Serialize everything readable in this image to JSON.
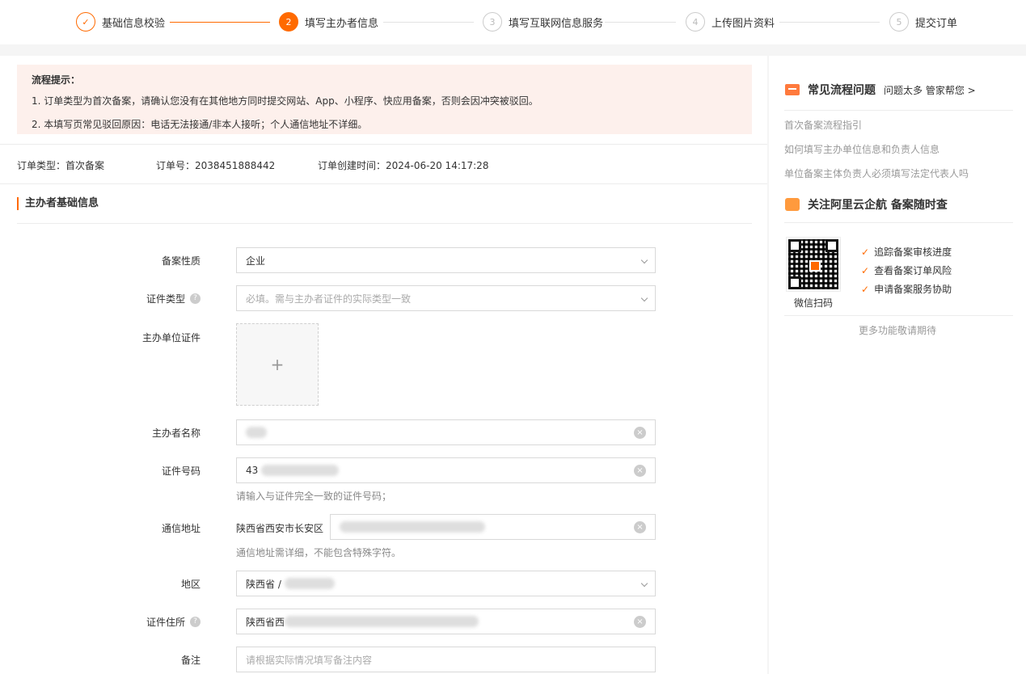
{
  "stepper": {
    "steps": [
      {
        "num": "✓",
        "label": "基础信息校验"
      },
      {
        "num": "2",
        "label": "填写主办者信息"
      },
      {
        "num": "3",
        "label": "填写互联网信息服务"
      },
      {
        "num": "4",
        "label": "上传图片资料"
      },
      {
        "num": "5",
        "label": "提交订单"
      }
    ]
  },
  "notice": {
    "title": "流程提示：",
    "line1": "1. 订单类型为首次备案，请确认您没有在其他地方同时提交网站、App、小程序、快应用备案，否则会因冲突被驳回。",
    "line2": "2. 本填写页常见驳回原因：电话无法接通/非本人接听；个人通信地址不详细。"
  },
  "order": {
    "type": "订单类型：首次备案",
    "number": "订单号：2038451888442",
    "created": "订单创建时间：2024-06-20 14:17:28"
  },
  "section": {
    "title": "主办者基础信息"
  },
  "form": {
    "record_nature_label": "备案性质",
    "record_nature_value": "企业",
    "cert_type_label": "证件类型",
    "cert_type_placeholder": "必填。需与主办者证件的实际类型一致",
    "org_cert_label": "主办单位证件",
    "upload_plus": "+",
    "sponsor_name_label": "主办者名称",
    "cert_number_label": "证件号码",
    "cert_number_value": "43",
    "cert_number_hint": "请输入与证件完全一致的证件号码；",
    "address_label": "通信地址",
    "address_prefix": "陕西省西安市长安区",
    "address_hint": "通信地址需详细，不能包含特殊字符。",
    "region_label": "地区",
    "region_value": "陕西省 /",
    "cert_address_label": "证件住所",
    "cert_address_value": "陕西省西",
    "remark_label": "备注",
    "remark_placeholder": "请根据实际情况填写备注内容",
    "help_glyph": "?",
    "clear_glyph": "×"
  },
  "sidebar": {
    "faq_title": "常见流程问题",
    "faq_more": "问题太多 管家帮您 >",
    "links": [
      "首次备案流程指引",
      "如何填写主办单位信息和负责人信息",
      "单位备案主体负责人必须填写法定代表人吗"
    ],
    "follow_title": "关注阿里云企航 备案随时查",
    "qr_label": "微信扫码",
    "features": [
      "追踪备案审核进度",
      "查看备案订单风险",
      "申请备案服务协助"
    ],
    "footer": "更多功能敬请期待"
  },
  "colors": {
    "accent": "#ff6a00",
    "notice_bg": "#fdf0ec"
  }
}
